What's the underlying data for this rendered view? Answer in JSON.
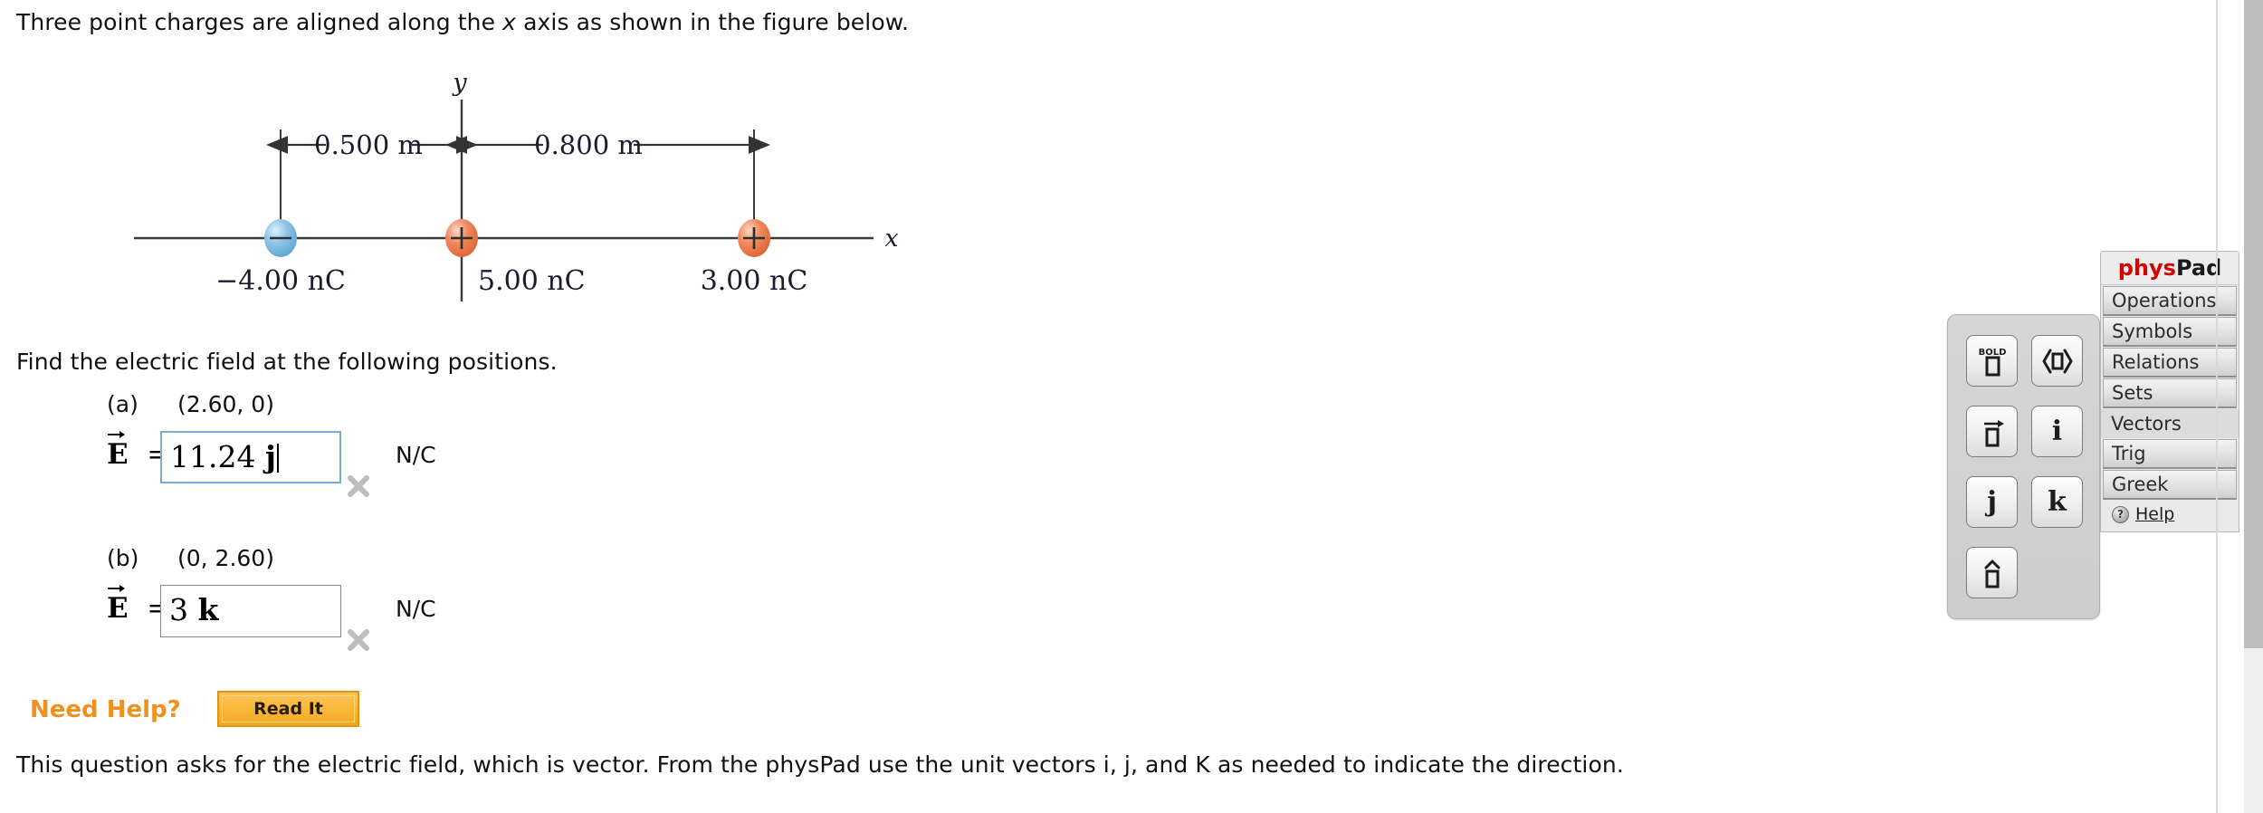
{
  "question": {
    "prompt_before_italic": "Three point charges are aligned along the ",
    "prompt_italic": "x",
    "prompt_after_italic": " axis as shown in the figure below.",
    "find_line": "Find the electric field at the following positions.",
    "note": "This question asks for the electric field, which is vector. From the physPad use the unit vectors i, j, and K as needed to indicate the direction."
  },
  "figure": {
    "y_axis_label": "y",
    "x_axis_label": "x",
    "dimension_left": "0.500 m",
    "dimension_right": "0.800 m",
    "charges": [
      {
        "sign": "−",
        "label": "−4.00 nC",
        "color": "#7fb8dd"
      },
      {
        "sign": "+",
        "label": "5.00 nC",
        "color": "#e8764a"
      },
      {
        "sign": "+",
        "label": "3.00 nC",
        "color": "#e8764a"
      }
    ]
  },
  "parts": [
    {
      "letter": "(a)",
      "coordinate": "(2.60, 0)",
      "symbol": "E",
      "equals": "=",
      "value_number": "11.24 ",
      "value_unitvec": "j",
      "units": "N/C",
      "state": "focused",
      "marked_incorrect": true
    },
    {
      "letter": "(b)",
      "coordinate": "(0, 2.60)",
      "symbol": "E",
      "equals": "=",
      "value_number": "3 ",
      "value_unitvec": "k",
      "units": "N/C",
      "state": "plain",
      "marked_incorrect": true
    }
  ],
  "need_help": {
    "label": "Need Help?",
    "button_label": "Read It"
  },
  "physpad": {
    "title_red": "phys",
    "title_rest": "Pad",
    "items": [
      {
        "label": "Operations",
        "active": false
      },
      {
        "label": "Symbols",
        "active": false
      },
      {
        "label": "Relations",
        "active": false
      },
      {
        "label": "Sets",
        "active": false
      },
      {
        "label": "Vectors",
        "active": true
      },
      {
        "label": "Trig",
        "active": false
      },
      {
        "label": "Greek",
        "active": false
      }
    ],
    "help": {
      "icon": "?",
      "label": "Help"
    },
    "keypad": [
      {
        "name": "bold-placeholder-key",
        "glyph": "□",
        "tag": "BOLD"
      },
      {
        "name": "angle-bracket-key",
        "glyph": "⟨□⟩",
        "tag": ""
      },
      {
        "name": "vector-arrow-key",
        "glyph": "□",
        "tag": "ARROW"
      },
      {
        "name": "unit-vector-i-key",
        "glyph": "i",
        "tag": ""
      },
      {
        "name": "unit-vector-j-key",
        "glyph": "j",
        "tag": ""
      },
      {
        "name": "unit-vector-k-key",
        "glyph": "k",
        "tag": ""
      },
      {
        "name": "hat-placeholder-key",
        "glyph": "□",
        "tag": "HAT"
      }
    ]
  },
  "colors": {
    "accent_orange": "#f0901e",
    "physpad_red": "#d60000",
    "focus_blue": "#7aadd4",
    "negative_charge": "#7fb8dd",
    "positive_charge": "#e8764a"
  }
}
